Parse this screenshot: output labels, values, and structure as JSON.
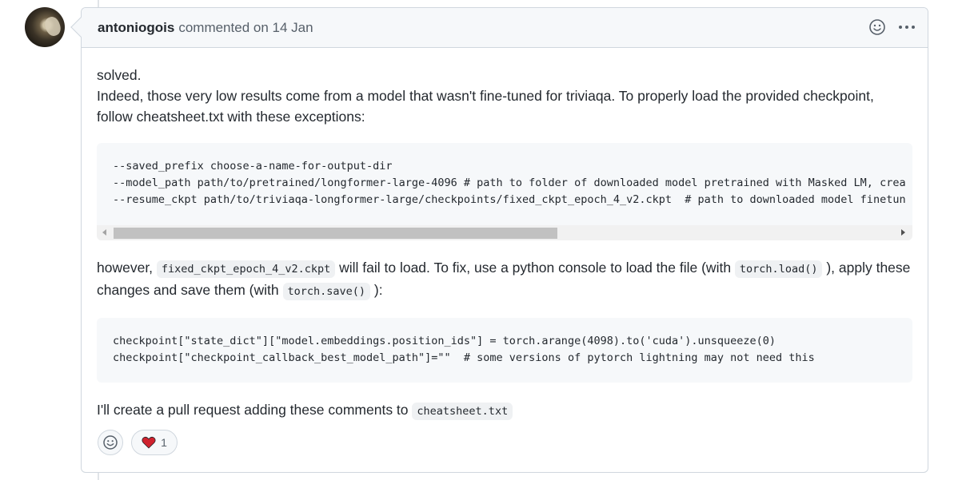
{
  "comment": {
    "author": "antoniogois",
    "action": "commented on 14 Jan",
    "paragraphs": {
      "p1": "solved.",
      "p2": "Indeed, those very low results come from a model that wasn't fine-tuned for triviaqa. To properly load the provided checkpoint,",
      "p3": "follow cheatsheet.txt with these exceptions:"
    },
    "code1": [
      "--saved_prefix choose-a-name-for-output-dir",
      "--model_path path/to/pretrained/longformer-large-4096 # path to folder of downloaded model pretrained with Masked LM, crea",
      "--resume_ckpt path/to/triviaqa-longformer-large/checkpoints/fixed_ckpt_epoch_4_v2.ckpt  # path to downloaded model finetun"
    ],
    "para2": {
      "t1": "however, ",
      "c1": "fixed_ckpt_epoch_4_v2.ckpt",
      "t2": " will fail to load. To fix, use a python console to load the file (with ",
      "c2": "torch.load()",
      "t3": " ), apply these",
      "t4": "changes and save them (with ",
      "c3": "torch.save()",
      "t5": " ):"
    },
    "code2": [
      "checkpoint[\"state_dict\"][\"model.embeddings.position_ids\"] = torch.arange(4098).to('cuda').unsqueeze(0)",
      "checkpoint[\"checkpoint_callback_best_model_path\"]=\"\"  # some versions of pytorch lightning may not need this"
    ],
    "para3": {
      "t1": "I'll create a pull request adding these comments to ",
      "c1": "cheatsheet.txt"
    },
    "reactions": {
      "heart_count": "1"
    }
  },
  "icons": {
    "smiley": "smiley-icon",
    "kebab": "kebab-horizontal-icon",
    "heart": "heart-icon",
    "add_reaction": "add-reaction-icon"
  },
  "colors": {
    "heart": "#cf222e",
    "border": "#d0d7de",
    "header_bg": "#f6f8fa"
  }
}
